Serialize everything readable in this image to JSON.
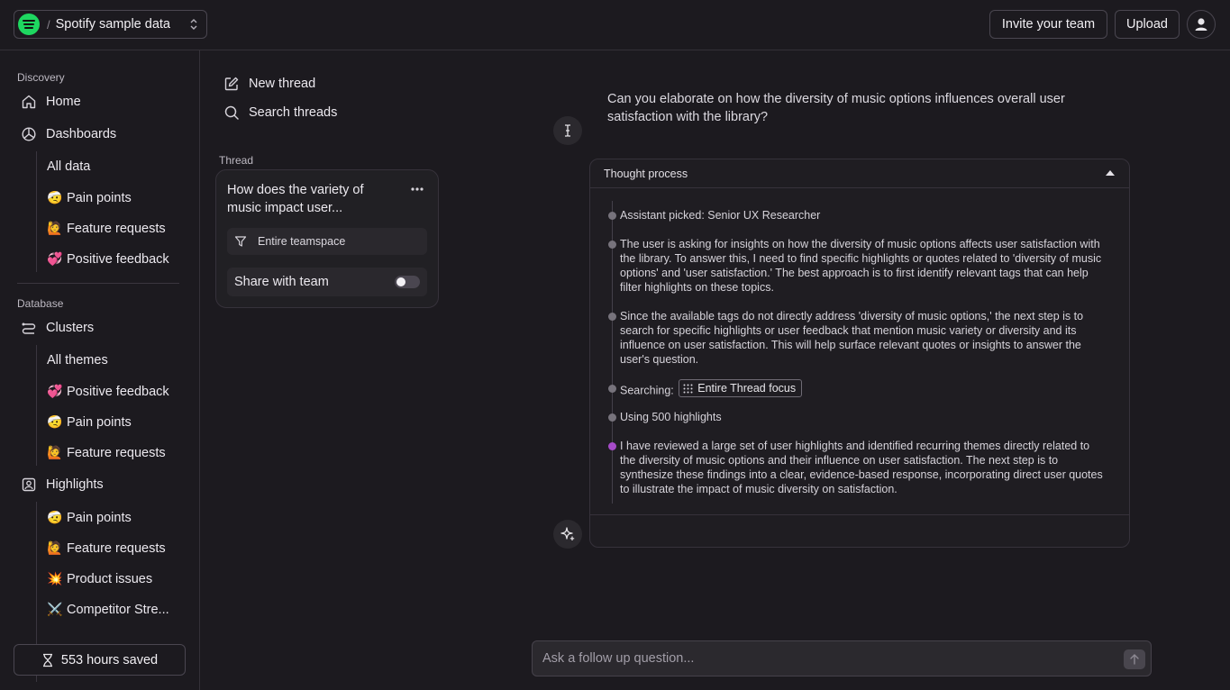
{
  "workspace": {
    "name": "Spotify sample data",
    "logo_icon": "spotify-logo-icon"
  },
  "topbar": {
    "invite_label": "Invite your team",
    "upload_label": "Upload",
    "avatar_icon": "user-icon"
  },
  "sidebar": {
    "discovery_label": "Discovery",
    "home": "Home",
    "dashboards": "Dashboards",
    "dashboard_items": [
      {
        "emoji": "",
        "label": "All data"
      },
      {
        "emoji": "🤕",
        "label": "Pain points"
      },
      {
        "emoji": "🙋",
        "label": "Feature requests"
      },
      {
        "emoji": "💞",
        "label": "Positive feedback"
      }
    ],
    "database_label": "Database",
    "clusters": "Clusters",
    "cluster_items": [
      {
        "emoji": "",
        "label": "All themes"
      },
      {
        "emoji": "💞",
        "label": "Positive feedback"
      },
      {
        "emoji": "🤕",
        "label": "Pain points"
      },
      {
        "emoji": "🙋",
        "label": "Feature requests"
      }
    ],
    "highlights": "Highlights",
    "highlight_items": [
      {
        "emoji": "🤕",
        "label": "Pain points"
      },
      {
        "emoji": "🙋",
        "label": "Feature requests"
      },
      {
        "emoji": "💥",
        "label": "Product issues"
      },
      {
        "emoji": "⚔️",
        "label": "Competitor Stre..."
      }
    ],
    "hours_saved": "553 hours saved"
  },
  "threads": {
    "new_thread": "New thread",
    "search_threads": "Search threads",
    "section_label": "Thread",
    "card": {
      "title": "How does the variety of music impact user...",
      "scope": "Entire teamspace",
      "share_label": "Share with team",
      "share_enabled": false
    }
  },
  "conversation": {
    "question": "Can you elaborate on how the diversity of music options influences overall user satisfaction with the library?",
    "thought_process_label": "Thought process",
    "steps": [
      "Assistant picked: Senior UX Researcher",
      "The user is asking for insights on how the diversity of music options affects user satisfaction with the library. To answer this, I need to find specific highlights or quotes related to 'diversity of music options' and 'user satisfaction.' The best approach is to first identify relevant tags that can help filter highlights on these topics.",
      "Since the available tags do not directly address 'diversity of music options,' the next step is to search for specific highlights or user feedback that mention music variety or diversity and its influence on user satisfaction. This will help surface relevant quotes or insights to answer the user's question.",
      "Searching:",
      "Using 500 highlights",
      "I have reviewed a large set of user highlights and identified recurring themes directly related to the diversity of music options and their influence on user satisfaction. The next step is to synthesize these findings into a clear, evidence-based response, incorporating direct user quotes to illustrate the impact of music diversity on satisfaction."
    ],
    "search_chip": "Entire Thread focus",
    "accent_color": "#a64bc8"
  },
  "ask": {
    "placeholder": "Ask a follow up question..."
  }
}
